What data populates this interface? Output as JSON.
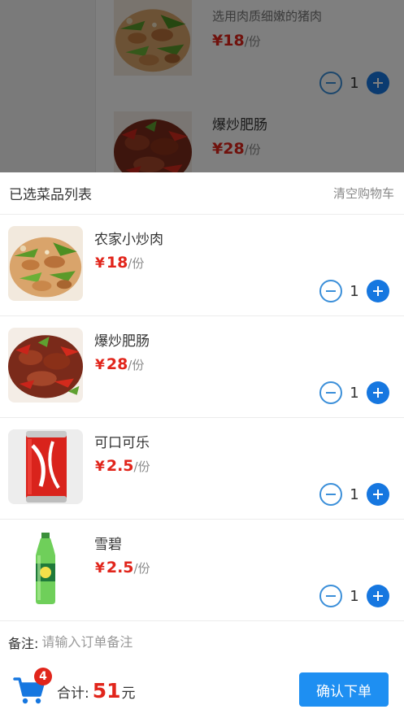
{
  "background_menu": {
    "items": [
      {
        "desc": "选用肉质细嫩的猪肉",
        "price": "18",
        "unit": "/份",
        "qty": "1"
      },
      {
        "name": "爆炒肥肠",
        "price": "28",
        "unit": "/份"
      }
    ]
  },
  "cart": {
    "title": "已选菜品列表",
    "clear_label": "清空购物车",
    "currency": "¥",
    "items": [
      {
        "name": "农家小炒肉",
        "price": "18",
        "unit": "/份",
        "qty": "1",
        "image": "stir-fry-pork"
      },
      {
        "name": "爆炒肥肠",
        "price": "28",
        "unit": "/份",
        "qty": "1",
        "image": "spicy-intestines"
      },
      {
        "name": "可口可乐",
        "price": "2.5",
        "unit": "/份",
        "qty": "1",
        "image": "coca-cola-can"
      },
      {
        "name": "雪碧",
        "price": "2.5",
        "unit": "/份",
        "qty": "1",
        "image": "sprite-bottle"
      }
    ]
  },
  "remark": {
    "label": "备注:",
    "placeholder": "请输入订单备注"
  },
  "footer": {
    "badge_count": "4",
    "total_label": "合计:",
    "total_amount": "51",
    "total_unit": "元",
    "confirm_label": "确认下单"
  },
  "colors": {
    "accent": "#1e8ff2",
    "price": "#e1251b",
    "plus": "#1677e0"
  },
  "icons": [
    "minus-icon",
    "plus-icon",
    "shopping-cart-icon"
  ]
}
